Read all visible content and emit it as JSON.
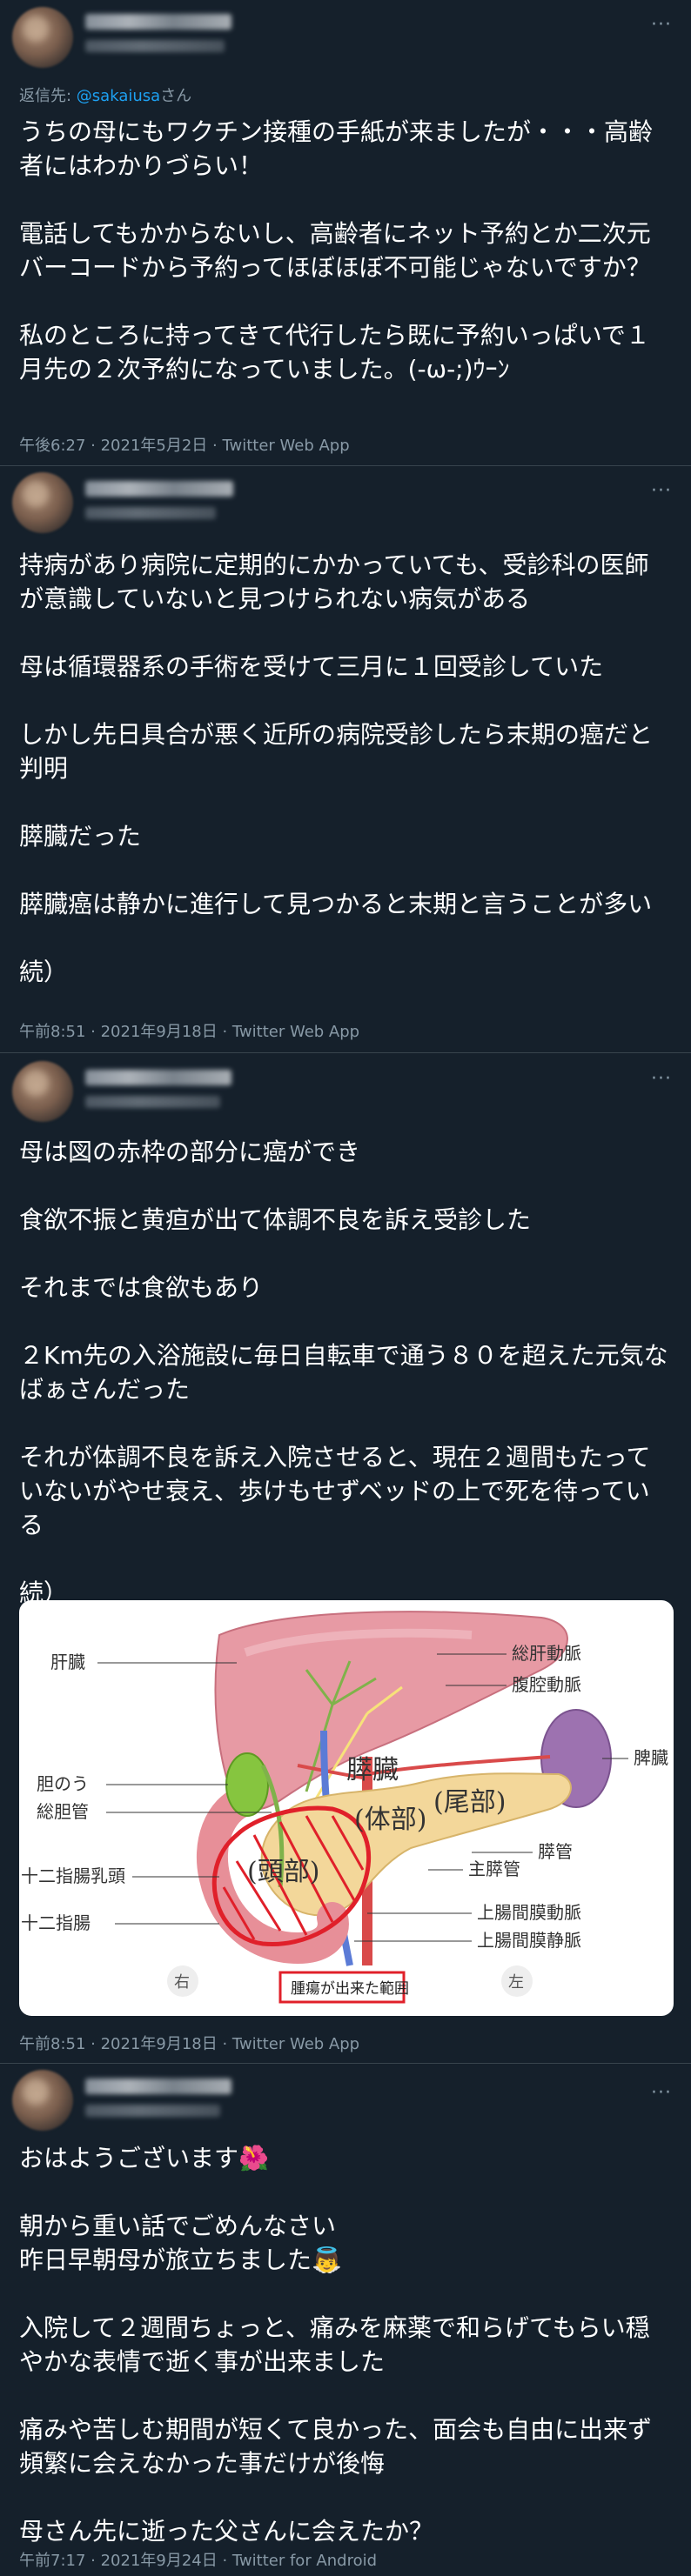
{
  "tweets": [
    {
      "reply_prefix": "返信先: ",
      "reply_handle": "@sakaiusa",
      "reply_suffix": "さん",
      "text": "うちの母にもワクチン接種の手紙が来ましたが・・・高齢者にはわかりづらい！\n\n電話してもかからないし、高齢者にネット予約とか二次元バーコードから予約ってほぼほぼ不可能じゃないですか？\n\n私のところに持ってきて代行したら既に予約いっぱいで１月先の２次予約になっていました。(-ω-;)ｳｰﾝ",
      "meta": "午後6:27 · 2021年5月2日 · Twitter Web App"
    },
    {
      "text": "持病があり病院に定期的にかかっていても、受診科の医師が意識していないと見つけられない病気がある\n\n母は循環器系の手術を受けて三月に１回受診していた\n\nしかし先日具合が悪く近所の病院受診したら末期の癌だと判明\n\n膵臓だった\n\n膵臓癌は静かに進行して見つかると末期と言うことが多い\n\n続）",
      "meta": "午前8:51 · 2021年9月18日 · Twitter Web App"
    },
    {
      "text": "母は図の赤枠の部分に癌ができ\n\n食欲不振と黄疸が出て体調不良を訴え受診した\n\nそれまでは食欲もあり\n\n２Km先の入浴施設に毎日自転車で通う８０を超えた元気なばぁさんだった\n\nそれが体調不良を訴え入院させると、現在２週間もたっていないがやせ衰え、歩けもせずベッドの上で死を待っている\n\n続）",
      "meta": "午前8:51 · 2021年9月18日 · Twitter Web App",
      "figure": {
        "labels": {
          "liver": "肝臓",
          "gallbladder": "胆のう",
          "bile_duct": "総胆管",
          "papilla": "十二指腸乳頭",
          "duodenum": "十二指腸",
          "hepatic_artery": "総肝動脈",
          "celiac_artery": "腹腔動脈",
          "spleen": "脾臓",
          "pancreatic_duct": "膵管",
          "main_pancreatic_duct": "主膵管",
          "sma": "上腸間膜動脈",
          "smv": "上腸間膜静脈",
          "pancreas": "膵臓",
          "body": "(体部)",
          "tail": "(尾部)",
          "head": "(頭部)",
          "right": "右",
          "left": "左",
          "caption": "腫瘍が出来た範囲"
        }
      }
    },
    {
      "text": "おはようございます🌺\n\n朝から重い話でごめんなさい\n昨日早朝母が旅立ちました👼\n\n入院して２週間ちょっと、痛みを麻薬で和らげてもらい穏やかな表情で逝く事が出来ました\n\n痛みや苦しむ期間が短くて良かった、面会も自由に出来ず頻繁に会えなかった事だけが後悔\n\n母さん先に逝った父さんに会えたか？",
      "meta": "午前7:17 · 2021年9月24日 · Twitter for Android"
    }
  ],
  "more_glyph": "···",
  "colors": {
    "background": "#15202b",
    "text": "#ffffff",
    "muted": "#8899a6",
    "link": "#1da1f2",
    "divider": "#38444d"
  }
}
